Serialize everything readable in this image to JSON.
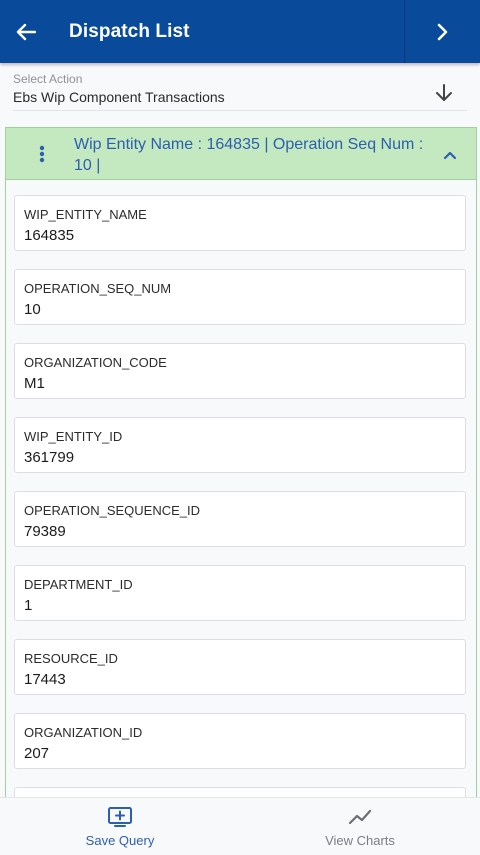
{
  "header": {
    "title": "Dispatch List"
  },
  "action": {
    "label": "Select Action",
    "value": "Ebs Wip Component Transactions"
  },
  "record": {
    "title": "Wip Entity Name : 164835 | Operation Seq Num : 10 |",
    "fields": [
      {
        "label": "WIP_ENTITY_NAME",
        "value": "164835"
      },
      {
        "label": "OPERATION_SEQ_NUM",
        "value": "10"
      },
      {
        "label": "ORGANIZATION_CODE",
        "value": "M1"
      },
      {
        "label": "WIP_ENTITY_ID",
        "value": "361799"
      },
      {
        "label": "OPERATION_SEQUENCE_ID",
        "value": "79389"
      },
      {
        "label": "DEPARTMENT_ID",
        "value": "1"
      },
      {
        "label": "RESOURCE_ID",
        "value": "17443"
      },
      {
        "label": "ORGANIZATION_ID",
        "value": "207"
      }
    ]
  },
  "footer": {
    "save_query": "Save Query",
    "view_charts": "View Charts"
  },
  "colors": {
    "header_bg": "#0a4a9a",
    "panel_header_bg": "#c4e8c0",
    "link_blue": "#2d5fb0",
    "muted": "#7a7d82"
  }
}
